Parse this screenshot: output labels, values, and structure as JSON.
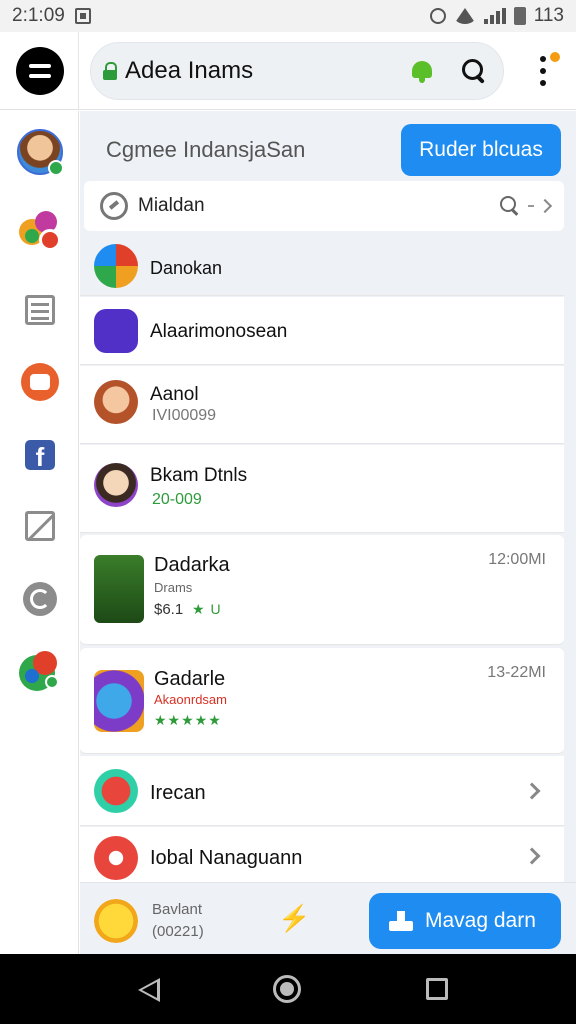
{
  "status_bar": {
    "time": "2:1:09",
    "battery": "113"
  },
  "app_bar": {
    "title": "Adea Inams"
  },
  "promo": {
    "text": "Cgmee IndansjaSan",
    "button_label": "Ruder blcuas"
  },
  "search_row": {
    "label": "Mialdan"
  },
  "list": [
    {
      "title": "Danokan",
      "icon": "pinwheel-icon"
    },
    {
      "title": "Alaarimonosean",
      "icon": "moon-app-icon"
    },
    {
      "title": "Aanol",
      "subtitle": "IVI00099",
      "icon": "girl-avatar-icon"
    },
    {
      "title": "Bkam Dtnls",
      "subtitle": "20-009",
      "icon": "boy-avatar-icon"
    },
    {
      "title": "Dadarka",
      "subtitle": "Drams",
      "meta": "$6.1",
      "rating_text": "★ U",
      "time": "12:00MI",
      "icon": "game-hero-icon"
    },
    {
      "title": "Gadarle",
      "subtitle": "Akaonrdsam",
      "rating_text": "★★★★★",
      "time": "13-22MI",
      "icon": "fish-game-icon"
    },
    {
      "title": "Irecan",
      "icon": "red-bird-icon"
    },
    {
      "title": "Iobal Nanaguann",
      "icon": "red-face-icon"
    }
  ],
  "bottom_strip": {
    "title": "Bavlant",
    "subtitle": "(00221)",
    "fab_label": "Mavag darn"
  },
  "colors": {
    "accent": "#1e8cf0",
    "green": "#2e9b3a",
    "red_text": "#d93025"
  }
}
